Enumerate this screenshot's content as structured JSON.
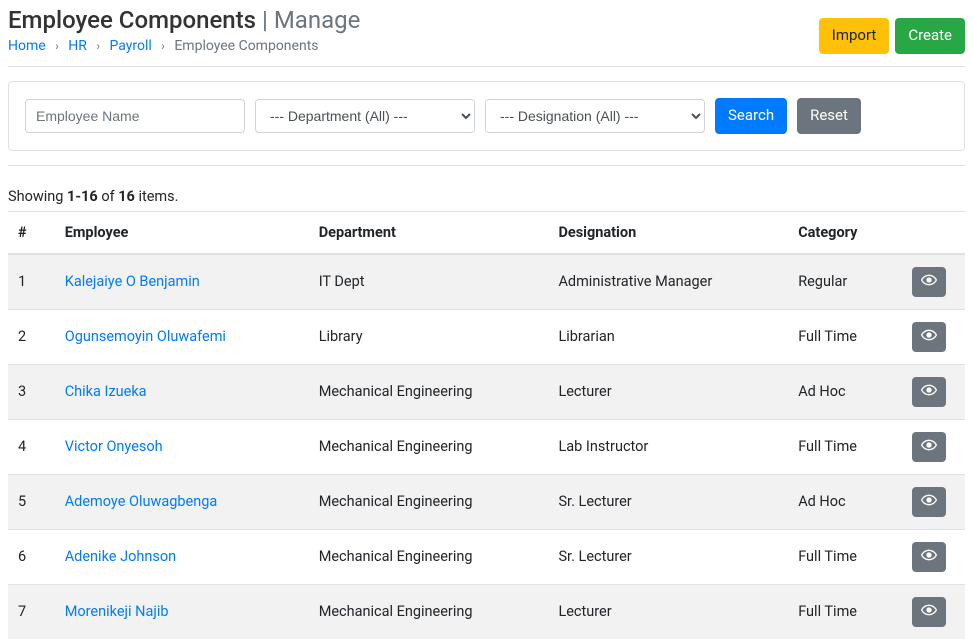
{
  "header": {
    "title": "Employee Components",
    "subtitle": "Manage",
    "separator": "|",
    "import_label": "Import",
    "create_label": "Create"
  },
  "breadcrumb": {
    "home": "Home",
    "hr": "HR",
    "payroll": "Payroll",
    "current": "Employee Components",
    "sep": "›"
  },
  "filter": {
    "name_placeholder": "Employee Name",
    "dept_selected": "--- Department (All) ---",
    "desig_selected": "--- Designation (All) ---",
    "search_label": "Search",
    "reset_label": "Reset"
  },
  "summary": {
    "prefix": "Showing ",
    "range": "1-16",
    "mid": " of ",
    "total": "16",
    "suffix": " items."
  },
  "table": {
    "headers": {
      "num": "#",
      "employee": "Employee",
      "department": "Department",
      "designation": "Designation",
      "category": "Category"
    },
    "rows": [
      {
        "num": "1",
        "employee": "Kalejaiye O Benjamin",
        "department": "IT Dept",
        "designation": "Administrative Manager",
        "category": "Regular"
      },
      {
        "num": "2",
        "employee": "Ogunsemoyin Oluwafemi",
        "department": "Library",
        "designation": "Librarian",
        "category": "Full Time"
      },
      {
        "num": "3",
        "employee": "Chika Izueka",
        "department": "Mechanical Engineering",
        "designation": "Lecturer",
        "category": "Ad Hoc"
      },
      {
        "num": "4",
        "employee": "Victor Onyesoh",
        "department": "Mechanical Engineering",
        "designation": "Lab Instructor",
        "category": "Full Time"
      },
      {
        "num": "5",
        "employee": "Ademoye Oluwagbenga",
        "department": "Mechanical Engineering",
        "designation": "Sr. Lecturer",
        "category": "Ad Hoc"
      },
      {
        "num": "6",
        "employee": "Adenike Johnson",
        "department": "Mechanical Engineering",
        "designation": "Sr. Lecturer",
        "category": "Full Time"
      },
      {
        "num": "7",
        "employee": "Morenikeji Najib",
        "department": "Mechanical Engineering",
        "designation": "Lecturer",
        "category": "Full Time"
      }
    ]
  },
  "icons": {
    "view": "eye-icon"
  }
}
